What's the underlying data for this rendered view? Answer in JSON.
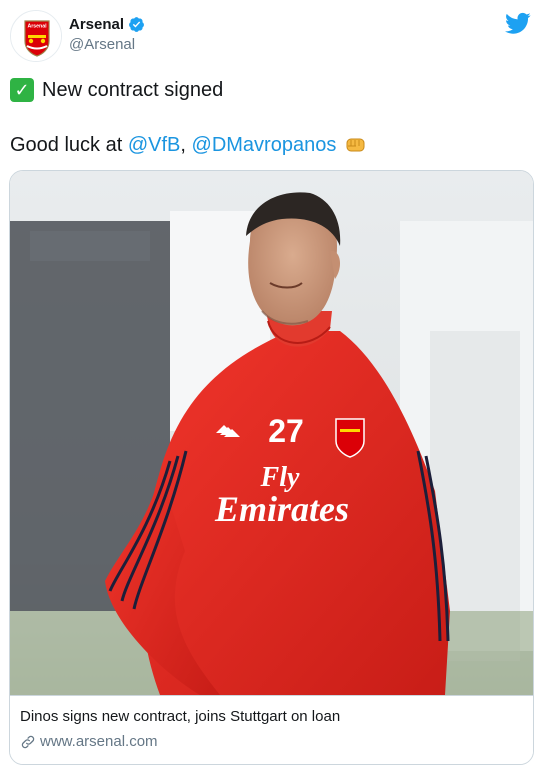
{
  "tweet": {
    "author": {
      "display_name": "Arsenal",
      "handle": "@Arsenal",
      "avatar_badge_text": "Arsenal"
    },
    "line1_text": "New contract signed",
    "line2_prefix": "Good luck at ",
    "mention1": "@VfB",
    "separator": ", ",
    "mention2": "@DMavropanos",
    "colors": {
      "mention": "#1b95e0",
      "twitter_blue": "#1da1f2",
      "checkmark_green": "#2fb344"
    }
  },
  "card": {
    "title": "Dinos signs new contract, joins Stuttgart on loan",
    "domain": "www.arsenal.com",
    "photo": {
      "shirt_number": "27",
      "sponsor_line1": "Fly",
      "sponsor_line2": "Emirates"
    }
  }
}
